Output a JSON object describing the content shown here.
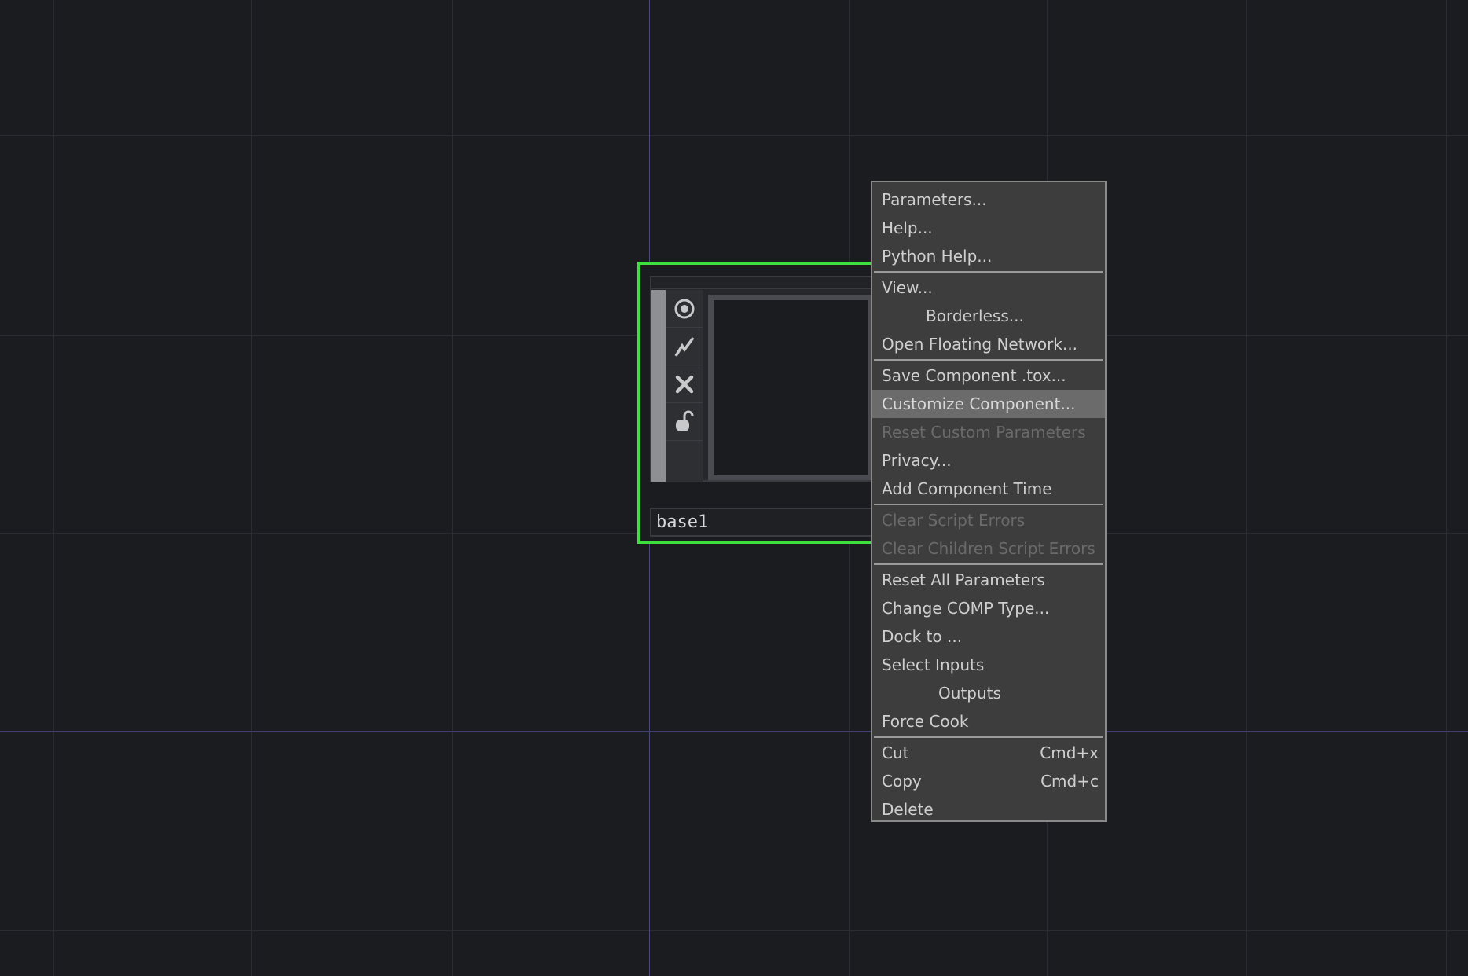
{
  "node": {
    "name": "base1",
    "toolbar_icons": [
      "viewer-active-icon",
      "bypass-icon",
      "close-icon",
      "lock-icon"
    ]
  },
  "context_menu": {
    "groups": [
      [
        {
          "label": "Parameters...",
          "state": "normal"
        },
        {
          "label": "Help...",
          "state": "normal"
        },
        {
          "label": "Python Help...",
          "state": "normal"
        }
      ],
      [
        {
          "label": "View...",
          "state": "normal"
        },
        {
          "label": "Borderless...",
          "state": "normal",
          "indent": 1
        },
        {
          "label": "Open Floating Network...",
          "state": "normal"
        }
      ],
      [
        {
          "label": "Save Component .tox...",
          "state": "normal"
        },
        {
          "label": "Customize Component...",
          "state": "highlight"
        },
        {
          "label": "Reset Custom Parameters",
          "state": "disabled"
        },
        {
          "label": "Privacy...",
          "state": "normal"
        },
        {
          "label": "Add Component Time",
          "state": "normal"
        }
      ],
      [
        {
          "label": "Clear Script Errors",
          "state": "disabled"
        },
        {
          "label": "Clear Children Script Errors",
          "state": "disabled"
        }
      ],
      [
        {
          "label": "Reset All Parameters",
          "state": "normal"
        },
        {
          "label": "Change COMP Type...",
          "state": "normal"
        },
        {
          "label": "Dock to ...",
          "state": "normal"
        },
        {
          "label": "Select Inputs",
          "state": "normal"
        },
        {
          "label": "Outputs",
          "state": "normal",
          "indent": 2
        },
        {
          "label": "Force Cook",
          "state": "normal"
        }
      ],
      [
        {
          "label": "Cut",
          "shortcut": "Cmd+x",
          "state": "normal"
        },
        {
          "label": "Copy",
          "shortcut": "Cmd+c",
          "state": "normal"
        },
        {
          "label": "Delete",
          "state": "normal"
        }
      ]
    ]
  },
  "colors": {
    "selection_border": "#3ee03e",
    "background": "#1b1c20",
    "menu_bg": "#3d3d3d",
    "menu_highlight": "#6b6b6b"
  }
}
